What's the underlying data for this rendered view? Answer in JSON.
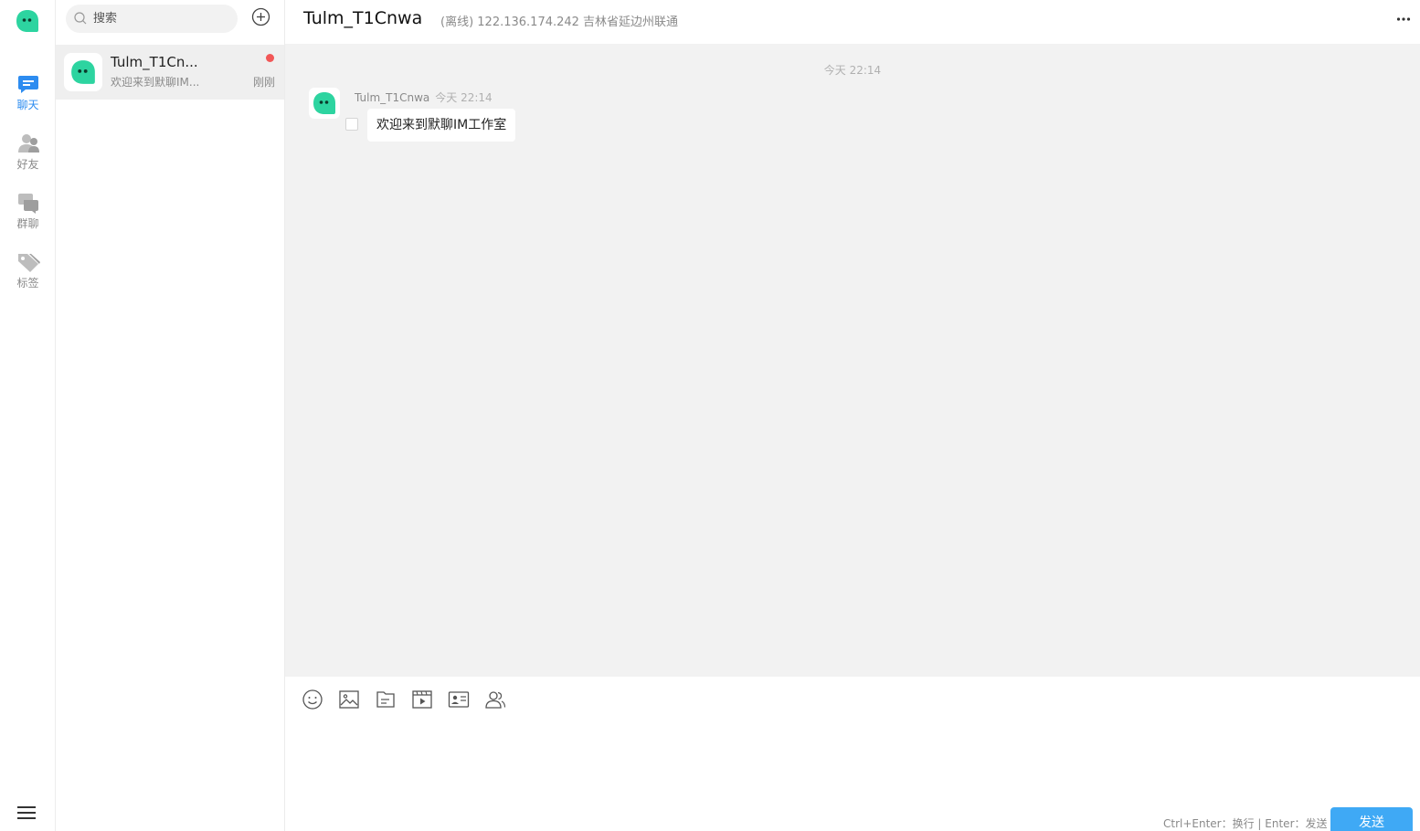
{
  "rail": {
    "items": [
      {
        "label": "聊天",
        "icon": "chat-icon",
        "active": true
      },
      {
        "label": "好友",
        "icon": "friends-icon",
        "active": false
      },
      {
        "label": "群聊",
        "icon": "group-chat-icon",
        "active": false
      },
      {
        "label": "标签",
        "icon": "tag-icon",
        "active": false
      }
    ]
  },
  "search": {
    "placeholder": "搜索"
  },
  "conversations": [
    {
      "name": "Tulm_T1Cn...",
      "preview": "欢迎来到默聊IM...",
      "time": "刚刚",
      "unread": true
    }
  ],
  "chat": {
    "title": "Tulm_T1Cnwa",
    "status": "(离线) 122.136.174.242 吉林省延边州联通",
    "timestamp": "今天 22:14",
    "messages": [
      {
        "sender": "Tulm_T1Cnwa",
        "time": "今天 22:14",
        "text": "欢迎来到默聊IM工作室"
      }
    ]
  },
  "toolbar": {
    "tools": [
      "emoji-icon",
      "image-icon",
      "file-icon",
      "video-icon",
      "contact-card-icon",
      "group-card-icon"
    ]
  },
  "composer": {
    "hint": "Ctrl+Enter：换行 | Enter：发送",
    "send_label": "发送"
  },
  "colors": {
    "accent": "#2d8cf0",
    "brand_green": "#2dd4a0",
    "unread_dot": "#f25757",
    "send_button": "#3fa9f5"
  }
}
